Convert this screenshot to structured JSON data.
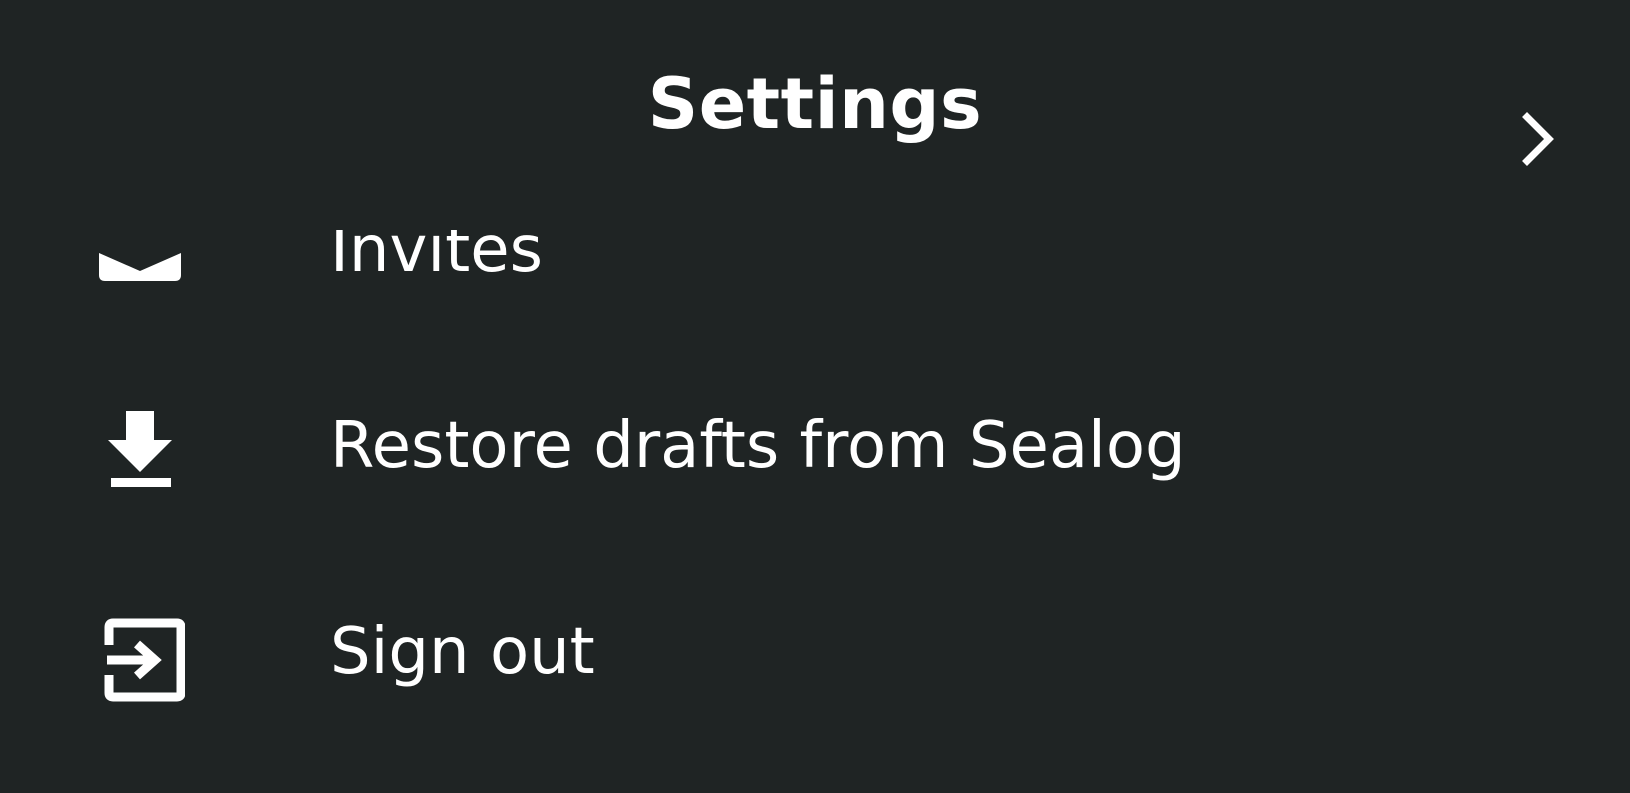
{
  "header": {
    "title": "Settings",
    "next_icon": "chevron-right-icon"
  },
  "menu": {
    "items": [
      {
        "label": "Invites",
        "icon": "mail-icon"
      },
      {
        "label": "Restore drafts from Sealog",
        "icon": "download-icon"
      },
      {
        "label": "Sign out",
        "icon": "sign-out-icon"
      }
    ]
  },
  "colors": {
    "background": "#1f2424",
    "foreground": "#ffffff"
  }
}
